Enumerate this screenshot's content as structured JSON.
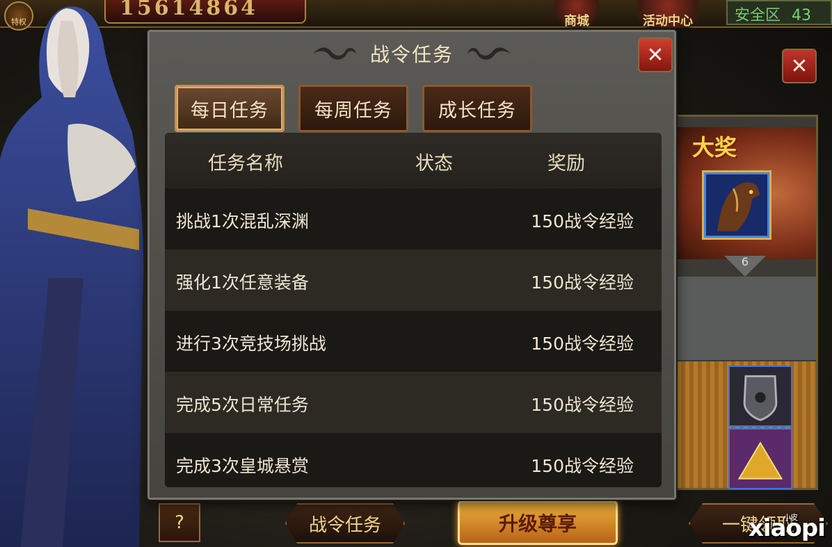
{
  "top_bar": {
    "special_label": "特权",
    "coin_count": "15614864",
    "menu_items": [
      "商城",
      "活动中心"
    ],
    "zone_label": "安全区",
    "zone_value": "43"
  },
  "modal": {
    "title": "战令任务",
    "close_symbol": "✕",
    "tabs": [
      {
        "label": "每日任务",
        "active": true
      },
      {
        "label": "每周任务",
        "active": false
      },
      {
        "label": "成长任务",
        "active": false
      }
    ],
    "columns": {
      "name": "任务名称",
      "status": "状态",
      "reward": "奖励"
    },
    "tasks": [
      {
        "name": "挑战1次混乱深渊",
        "status": "",
        "reward": "150战令经验"
      },
      {
        "name": "强化1次任意装备",
        "status": "",
        "reward": "150战令经验"
      },
      {
        "name": "进行3次竞技场挑战",
        "status": "",
        "reward": "150战令经验"
      },
      {
        "name": "完成5次日常任务",
        "status": "",
        "reward": "150战令经验"
      },
      {
        "name": "完成3次皇城悬赏",
        "status": "",
        "reward": "150战令经验"
      }
    ]
  },
  "side_panel": {
    "prize_title": "大奖",
    "level": "6",
    "close_symbol": "✕"
  },
  "bottom_bar": {
    "help_label": "?",
    "battle_task_label": "战令任务",
    "upgrade_label": "升级尊享",
    "claim_all_label": "一键领取"
  },
  "watermark": {
    "text": "xiaopi",
    "small": "小皮"
  },
  "colors": {
    "accent_gold": "#f2d48a",
    "close_red": "#d23c2e",
    "safe_zone_green": "#78c774"
  }
}
